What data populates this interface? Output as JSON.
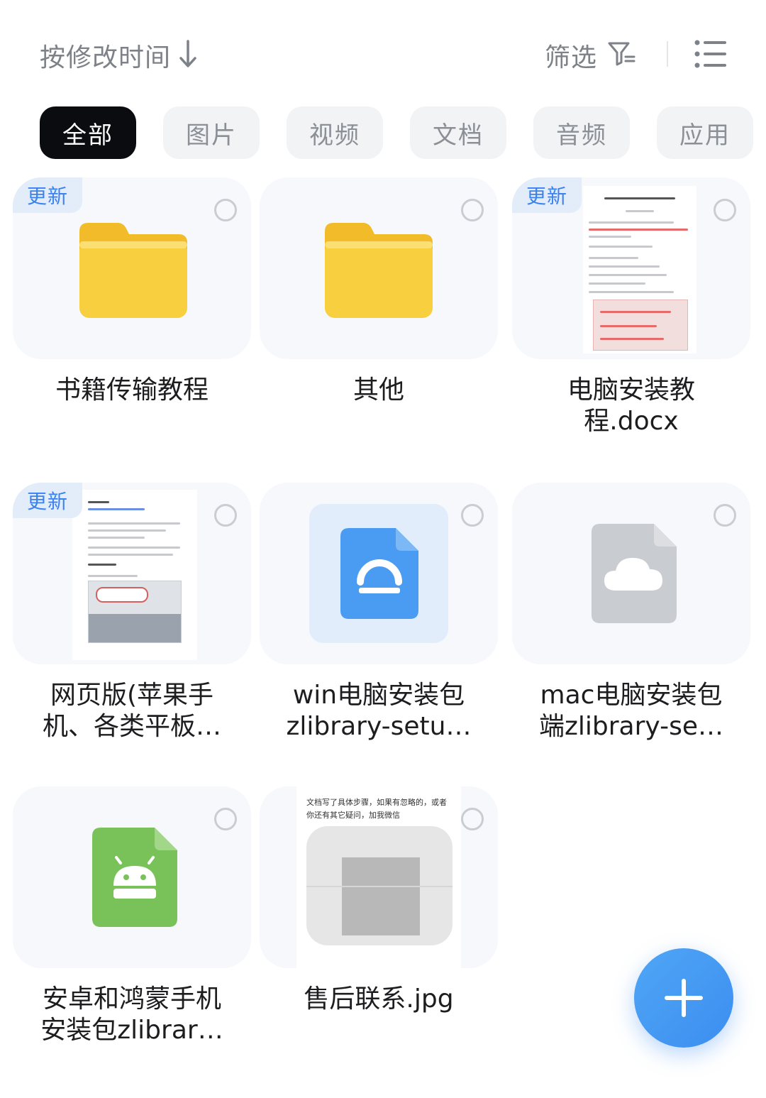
{
  "header": {
    "sort_label": "按修改时间",
    "filter_label": "筛选"
  },
  "tabs": [
    {
      "label": "全部",
      "active": true
    },
    {
      "label": "图片",
      "active": false
    },
    {
      "label": "视频",
      "active": false
    },
    {
      "label": "文档",
      "active": false
    },
    {
      "label": "音频",
      "active": false
    },
    {
      "label": "应用",
      "active": false
    }
  ],
  "files": [
    {
      "name": "书籍传输教程",
      "type": "folder",
      "badge": "更新"
    },
    {
      "name": "其他",
      "type": "folder",
      "badge": ""
    },
    {
      "name": "电脑安装教程.docx",
      "name_lines": [
        "电脑安装教",
        "程.docx"
      ],
      "type": "docx",
      "badge": "更新"
    },
    {
      "name_lines": [
        "网页版(苹果手",
        "机、各类平板…"
      ],
      "type": "doc",
      "badge": "更新"
    },
    {
      "name_lines": [
        "win电脑安装包",
        "zlibrary-setu…"
      ],
      "type": "installer",
      "badge": ""
    },
    {
      "name_lines": [
        "mac电脑安装包",
        "端zlibrary-se…"
      ],
      "type": "cloud-file",
      "badge": ""
    },
    {
      "name_lines": [
        "安卓和鸿蒙手机",
        "安装包zlibrar…"
      ],
      "type": "apk",
      "badge": ""
    },
    {
      "name": "售后联系.jpg",
      "type": "image",
      "badge": ""
    }
  ],
  "thumb_text": {
    "aftersale_line1": "文档写了具体步骤，如果有忽略的，或者",
    "aftersale_line2": "你还有其它疑问，加我微信"
  },
  "colors": {
    "accent": "#3a82f0",
    "folder": "#f8cf3e",
    "apk": "#79c25a",
    "active_tab": "#0b0c0f"
  },
  "fab_icon": "plus-icon"
}
